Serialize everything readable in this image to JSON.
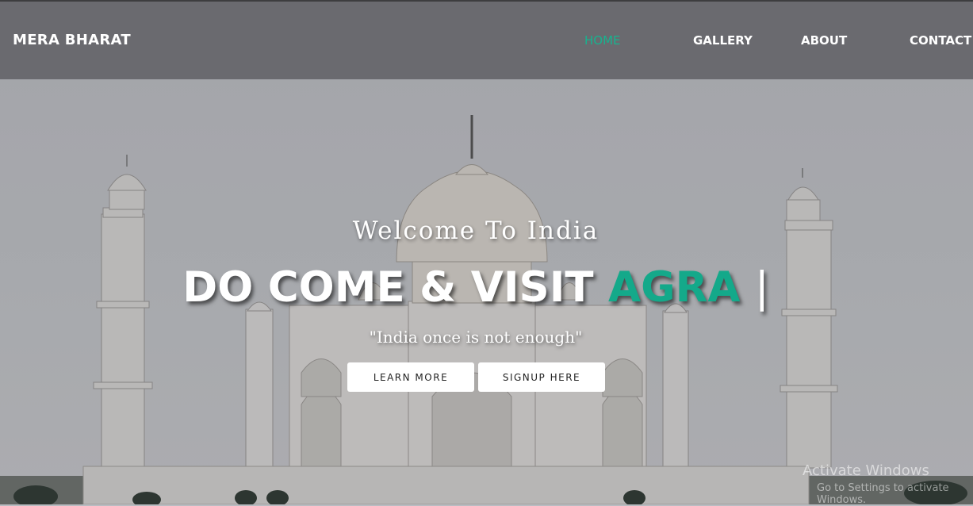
{
  "header": {
    "brand": "MERA BHARAT",
    "nav": [
      {
        "label": "HOME",
        "active": true
      },
      {
        "label": "GALLERY",
        "active": false
      },
      {
        "label": "ABOUT",
        "active": false
      },
      {
        "label": "CONTACT",
        "active": false
      }
    ]
  },
  "hero": {
    "welcome": "Welcome To India",
    "headline_prefix": "DO COME & VISIT",
    "headline_accent": "AGRA",
    "cursor": "|",
    "tagline": "\"India once is not enough\"",
    "buttons": {
      "learn_more": "LEARN MORE",
      "signup": "SIGNUP HERE"
    }
  },
  "watermark": {
    "title": "Activate Windows",
    "subtitle": "Go to Settings to activate Windows."
  },
  "colors": {
    "accent": "#14a98a",
    "nav_active": "#17b38f",
    "navbar_bg": "#626266"
  }
}
